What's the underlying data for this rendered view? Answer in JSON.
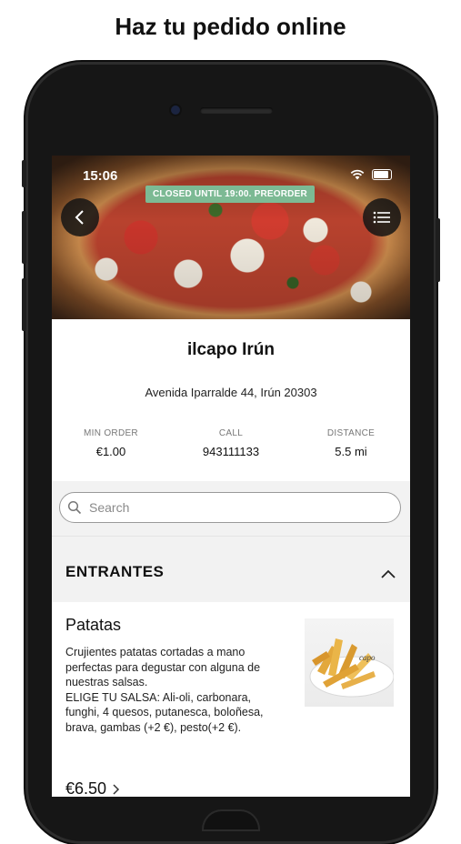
{
  "page": {
    "headline": "Haz tu pedido online"
  },
  "status_bar": {
    "time": "15:06"
  },
  "hero": {
    "badge": "CLOSED UNTIL 19:00. PREORDER",
    "back_icon": "chevron-left-icon",
    "menu_icon": "menu-icon"
  },
  "restaurant": {
    "name": "ilcapo Irún",
    "address": "Avenida Iparralde 44, Irún 20303",
    "stats": [
      {
        "label": "MIN ORDER",
        "value": "€1.00"
      },
      {
        "label": "CALL",
        "value": "943111133"
      },
      {
        "label": "DISTANCE",
        "value": "5.5 mi"
      }
    ]
  },
  "search": {
    "placeholder": "Search"
  },
  "section": {
    "title": "ENTRANTES",
    "toggle_icon": "chevron-up-icon"
  },
  "item": {
    "title": "Patatas",
    "description": "Crujientes patatas cortadas a mano perfectas para degustar con alguna de nuestras salsas.\nELIGE TU SALSA: Ali-oli, carbonara, funghi, 4 quesos, putanesca, boloñesa, brava, gambas (+2 €), pesto(+2 €).",
    "price": "€6.50",
    "price_icon": "chevron-right-icon"
  },
  "colors": {
    "badge": "#7fc9a2",
    "frame": "#161616"
  }
}
